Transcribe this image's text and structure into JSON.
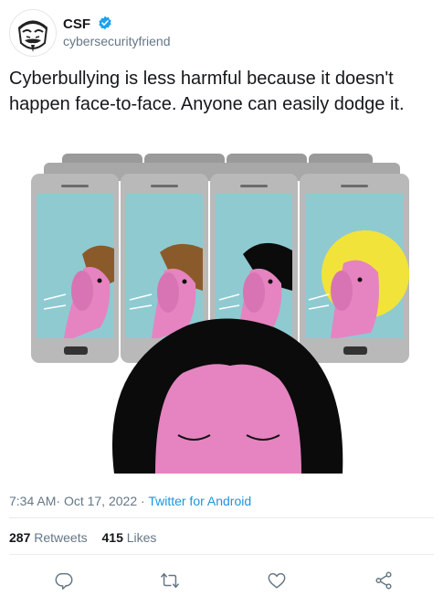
{
  "author": {
    "name": "CSF",
    "handle": "cybersecurityfriend",
    "verified": true,
    "accent": "#1da1f2"
  },
  "tweet": {
    "text": "Cyberbullying is less harmful because it doesn't happen face-to-face. Anyone can easily dodge it.",
    "time": "7:34 AM",
    "date": "Oct 17, 2022",
    "separator": "·",
    "source": "Twitter for Android"
  },
  "stats": {
    "retweets_count": "287",
    "retweets_label": "Retweets",
    "likes_count": "415",
    "likes_label": "Likes"
  },
  "actions": [
    {
      "icon": "reply-icon"
    },
    {
      "icon": "retweet-icon"
    },
    {
      "icon": "like-icon"
    },
    {
      "icon": "share-icon"
    }
  ],
  "colors": {
    "link": "#1b95e0",
    "muted": "#657786",
    "text": "#14171a",
    "screen": "#8fcad1",
    "phone": "#b9b9b9",
    "skin": "#e584c0",
    "hair_dark": "#0b0b0b"
  }
}
